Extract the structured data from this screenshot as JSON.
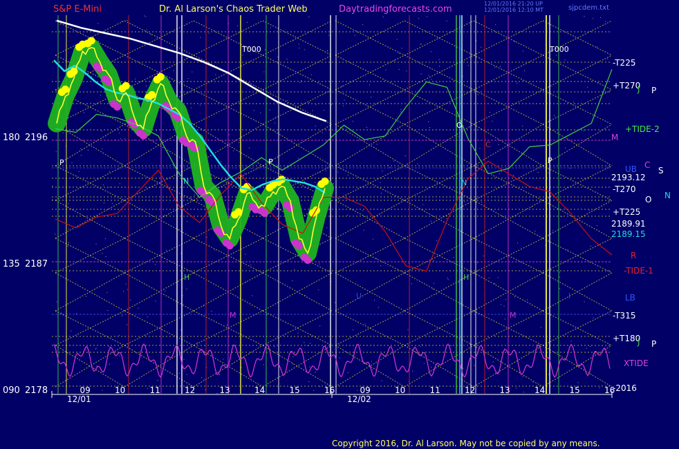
{
  "header": {
    "symbol": "S&P E-Mini",
    "site_title": "Dr. Al Larson's Chaos Trader Web",
    "site_url": "Daytradingforecasts.com",
    "stamp_1": "12/01/2016 21:20 UP",
    "stamp_2": "12/01/2016 12:10 MT",
    "file_name": "sjpcdem.txt"
  },
  "footer": {
    "copyright": "Copyright 2016, Dr. Al Larson. May not be copied by any means."
  },
  "colors": {
    "background": "#000066",
    "price_band": "#1fb31f",
    "up_dot": "#ffff00",
    "down_dot": "#cc33cc",
    "average_short": "#22dddd",
    "average_long": "#ffffff",
    "price_line": "#ffff33",
    "tide_green": "#44cc44",
    "tide_red": "#cc1111",
    "xtide": "#cc33cc",
    "grid_yellow": "#c8c840"
  },
  "chart_data": {
    "type": "line",
    "title": "S&P E-Mini",
    "price_range": [
      2178,
      2199
    ],
    "x_ticks_day1": [
      "09",
      "10",
      "11",
      "12",
      "13",
      "14",
      "15",
      "16"
    ],
    "x_ticks_day2": [
      "09",
      "10",
      "11",
      "12",
      "13",
      "14",
      "15",
      "16"
    ],
    "dates": [
      "12/01",
      "12/02"
    ],
    "y_labels": [
      {
        "angle": "180",
        "price": "2196"
      },
      {
        "angle": "135",
        "price": "2187"
      },
      {
        "angle": "090",
        "price": "2178"
      }
    ],
    "right_labels": [
      {
        "text": "-T225",
        "color": "#ffffff"
      },
      {
        "text": "+T270",
        "color": "#ffffff"
      },
      {
        "text": "+TIDE-2",
        "color": "#44ee44"
      },
      {
        "text": "UB",
        "color": "#3355ff"
      },
      {
        "text": "2193.12",
        "color": "#ffffff"
      },
      {
        "text": "-T270",
        "color": "#ffffff"
      },
      {
        "text": "+T225",
        "color": "#ffffff"
      },
      {
        "text": "2189.91",
        "color": "#ffffff"
      },
      {
        "text": "2189.15",
        "color": "#22dddd"
      },
      {
        "text": "R",
        "color": "#ee2222"
      },
      {
        "text": "-TIDE-1",
        "color": "#ee2222"
      },
      {
        "text": "LB",
        "color": "#3355ff"
      },
      {
        "text": "-T315",
        "color": "#ffffff"
      },
      {
        "text": "+T180",
        "color": "#ffffff"
      },
      {
        "text": "XTIDE",
        "color": "#dd44dd"
      },
      {
        "text": "-2016",
        "color": "#ffffff"
      }
    ],
    "planet_labels": [
      {
        "text": "J",
        "color": "#44cc44"
      },
      {
        "text": "P",
        "color": "#ffffff"
      },
      {
        "text": "M",
        "color": "#dd44dd"
      },
      {
        "text": "C",
        "color": "#dd44dd"
      },
      {
        "text": "S",
        "color": "#ffffff"
      },
      {
        "text": "N",
        "color": "#22dddd"
      },
      {
        "text": "O",
        "color": "#ffffff"
      },
      {
        "text": "J",
        "color": "#44cc44"
      },
      {
        "text": "P",
        "color": "#ffffff"
      }
    ],
    "t000_label": "T000",
    "in_chart_letters": [
      "P",
      "P",
      "P",
      "N",
      "H",
      "M",
      "O",
      "N",
      "H",
      "C",
      "M",
      "U",
      "J",
      "I"
    ],
    "series": [
      {
        "name": "price",
        "values": [
          2193.0,
          2194.5,
          2195.5,
          2197.0,
          2197.2,
          2196.4,
          2195.7,
          2194.3,
          2194.7,
          2193.3,
          2192.7,
          2194.2,
          2195.2,
          2194.2,
          2193.7,
          2192.3,
          2192.0,
          2189.5,
          2189.0,
          2187.3,
          2186.6,
          2187.7,
          2189.1,
          2188.6,
          2188.4,
          2189.2,
          2189.5,
          2188.7,
          2186.6,
          2185.8,
          2187.8,
          2189.4
        ]
      },
      {
        "name": "short-average",
        "values": [
          2196.5,
          2195.9,
          2196.2,
          2195.8,
          2195.3,
          2194.9,
          2194.7,
          2194.6,
          2194.4,
          2194.3,
          2194.1,
          2193.8,
          2193.5,
          2193.0,
          2192.3,
          2191.5,
          2190.7,
          2190.0,
          2189.4,
          2189.3,
          2189.6,
          2189.8,
          2189.9,
          2189.8,
          2189.7,
          2189.5,
          2189.15
        ]
      },
      {
        "name": "long-average",
        "values": [
          2198.7,
          2198.3,
          2198.0,
          2197.7,
          2197.3,
          2196.9,
          2196.4,
          2195.8,
          2195.0,
          2194.2,
          2193.6,
          2193.12
        ]
      },
      {
        "name": "+TIDE-2",
        "values": [
          2192.7,
          2192.5,
          2193.5,
          2193.3,
          2192.9,
          2192.3,
          2190.2,
          2188.9,
          2189.7,
          2190.3,
          2191.1,
          2190.4,
          2191.1,
          2191.8,
          2192.9,
          2192.1,
          2192.3,
          2193.9,
          2195.3,
          2195.0,
          2192.2,
          2190.2,
          2190.5,
          2191.7,
          2191.8,
          2192.4,
          2193.0,
          2196.0
        ]
      },
      {
        "name": "-TIDE-1",
        "values": [
          2187.7,
          2187.2,
          2187.8,
          2188.0,
          2189.2,
          2190.4,
          2188.4,
          2187.5,
          2189.0,
          2190.2,
          2188.6,
          2187.4,
          2186.9,
          2188.9,
          2188.9,
          2188.4,
          2187.0,
          2185.1,
          2184.8,
          2187.6,
          2189.9,
          2190.9,
          2190.2,
          2189.5,
          2189.2,
          2188.0,
          2186.6,
          2185.7
        ]
      },
      {
        "name": "XTIDE",
        "values": []
      }
    ]
  }
}
